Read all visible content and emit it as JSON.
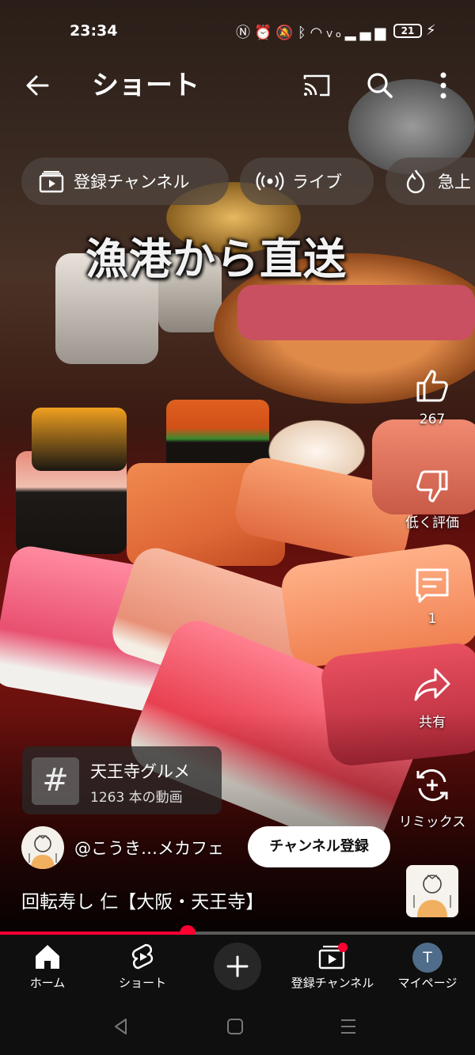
{
  "status_bar": {
    "time": "23:34",
    "icons": [
      "nfc-icon",
      "alarm-icon",
      "mute-icon",
      "bluetooth-icon",
      "wifi-icon",
      "volte-icon",
      "signal-icon"
    ],
    "battery": "21"
  },
  "header": {
    "title": "ショート",
    "back_icon": "back-arrow-icon",
    "cast_icon": "cast-icon",
    "search_icon": "search-icon",
    "more_icon": "more-vert-icon"
  },
  "chips": [
    {
      "label": "登録チャンネル",
      "icon": "subscriptions-icon"
    },
    {
      "label": "ライブ",
      "icon": "live-icon"
    },
    {
      "label": "急上",
      "icon": "trending-icon"
    }
  ],
  "video": {
    "caption_overlay": "漁港から直送",
    "title": "回転寿し 仁【大阪・天王寺】",
    "progress": 0.395
  },
  "actions": {
    "like_count": "267",
    "dislike_label": "低く評価",
    "comments_count": "1",
    "share_label": "共有",
    "remix_label": "リミックス"
  },
  "hashtag": {
    "name": "天王寺グルメ",
    "count": "1263 本の動画"
  },
  "channel": {
    "name": "@こうき…メカフェ",
    "subscribe_label": "チャンネル登録"
  },
  "bottom_nav": {
    "home": "ホーム",
    "shorts": "ショート",
    "subscriptions": "登録チャンネル",
    "you": "マイページ",
    "avatar_letter": "T"
  },
  "colors": {
    "accent": "#ff0033",
    "nav_bg": "#0f0f0f"
  }
}
